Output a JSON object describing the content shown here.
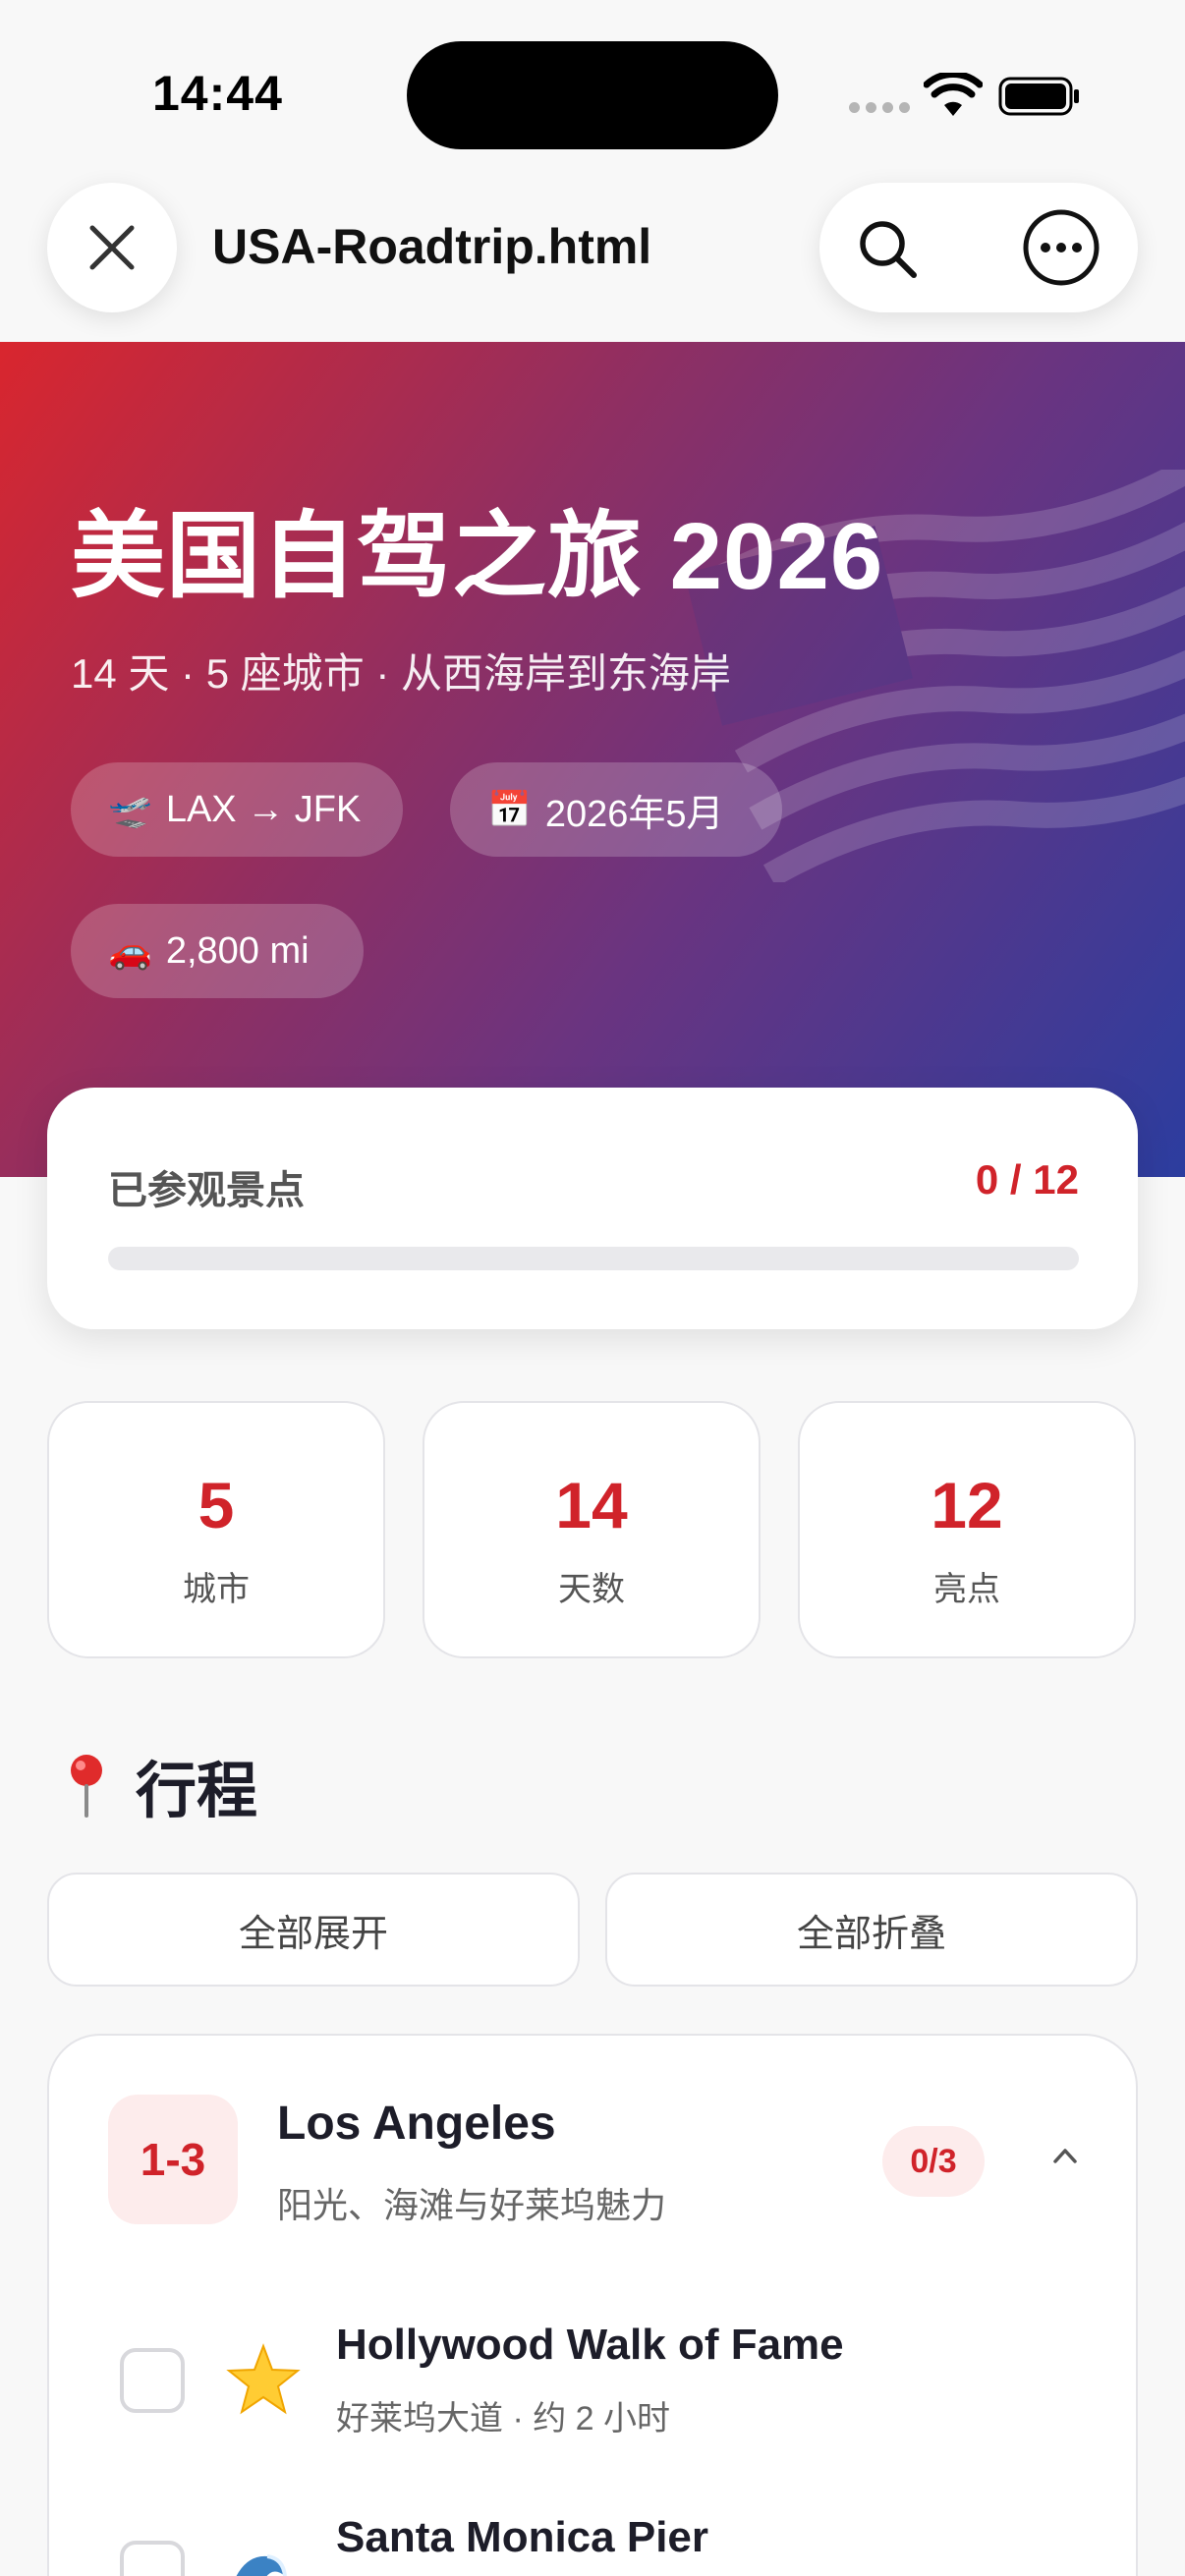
{
  "status_bar": {
    "time": "14:44"
  },
  "nav": {
    "title": "USA-Roadtrip.html"
  },
  "hero": {
    "title": "美国自驾之旅 2026",
    "subtitle": "14 天 · 5 座城市 · 从西海岸到东海岸",
    "chips": [
      {
        "icon": "🛫",
        "label": "LAX → JFK"
      },
      {
        "icon": "📅",
        "label": "2026年5月"
      },
      {
        "icon": "🚗",
        "label": "2,800 mi"
      }
    ]
  },
  "progress": {
    "label": "已参观景点",
    "count": "0 / 12",
    "fraction": 0
  },
  "stats": [
    {
      "value": "5",
      "label": "城市"
    },
    {
      "value": "14",
      "label": "天数"
    },
    {
      "value": "12",
      "label": "亮点"
    }
  ],
  "itinerary": {
    "title": "行程",
    "expand_all": "全部展开",
    "collapse_all": "全部折叠",
    "cities": [
      {
        "days": "1-3",
        "name": "Los Angeles",
        "tagline": "阳光、海滩与好莱坞魅力",
        "visited": "0/3",
        "spots": [
          {
            "icon": "star",
            "name": "Hollywood Walk of Fame",
            "desc": "好莱坞大道 · 约 2 小时"
          },
          {
            "icon": "wave",
            "name": "Santa Monica Pier",
            "desc": ""
          }
        ]
      }
    ]
  },
  "colors": {
    "accent": "#d0232a",
    "hero_start": "#d9262e",
    "hero_end": "#2c3d9f"
  }
}
